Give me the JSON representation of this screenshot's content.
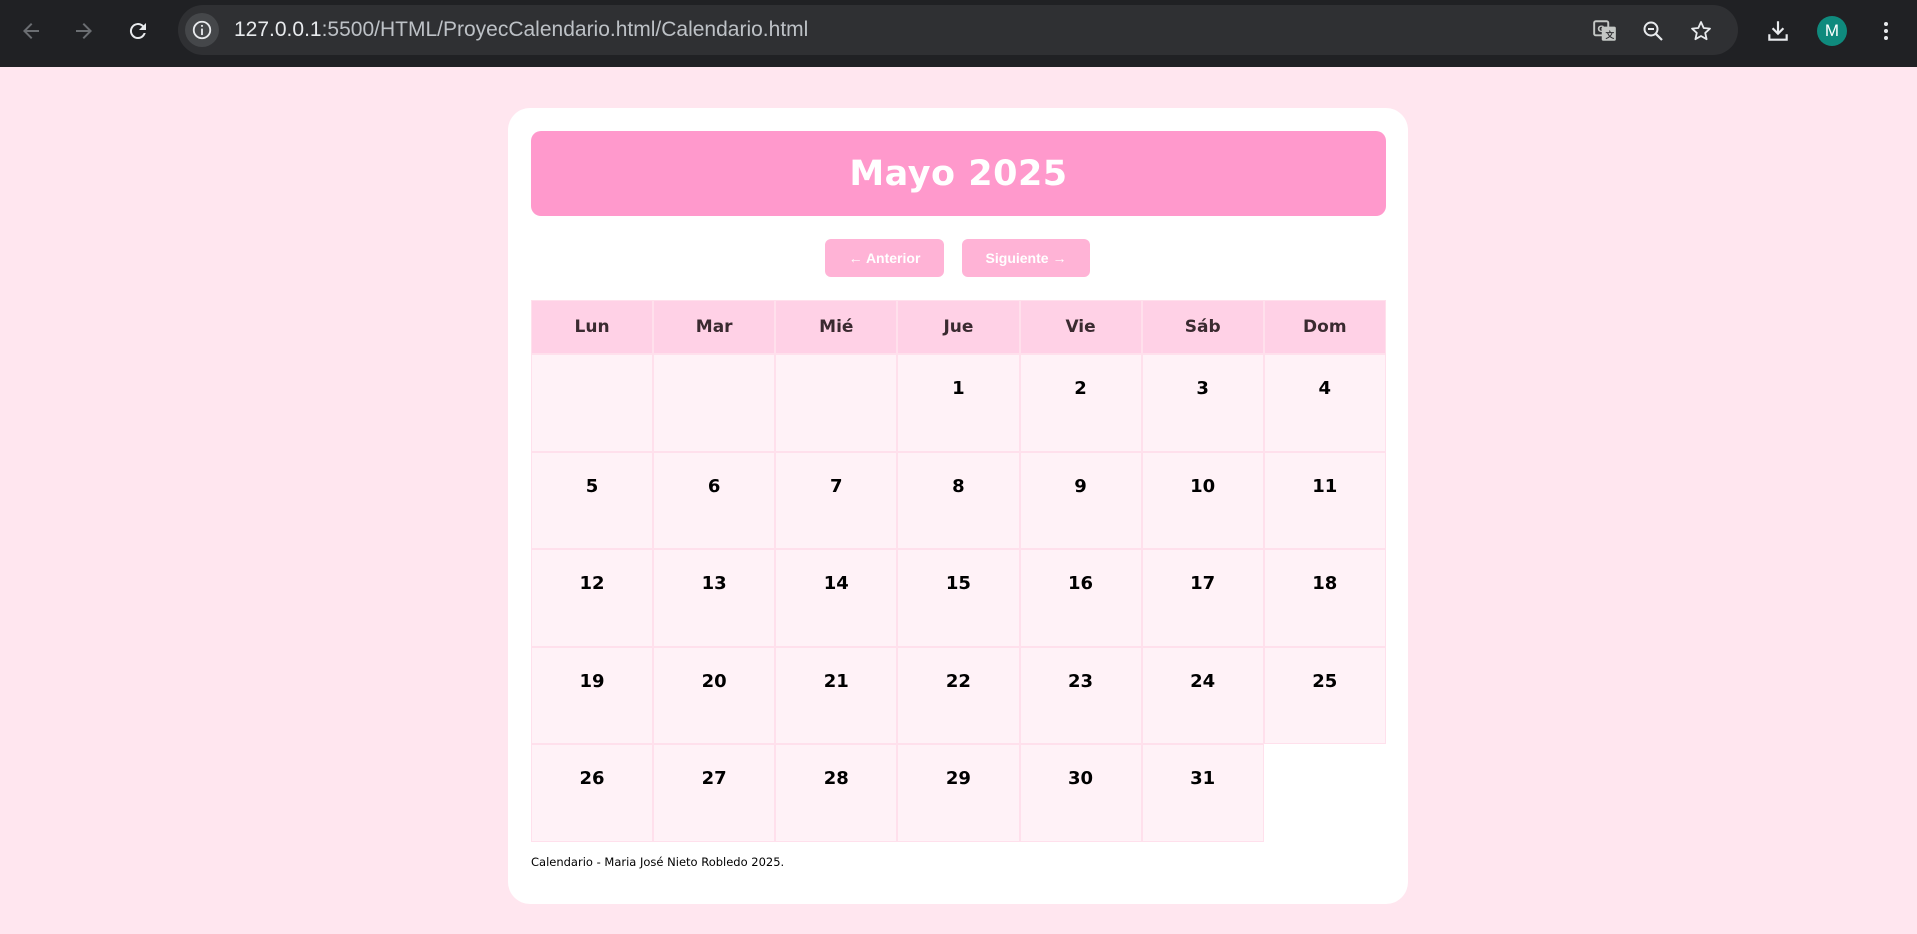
{
  "browser": {
    "url_host": "127.0.0.1",
    "url_rest": ":5500/HTML/ProyecCalendario.html/Calendario.html",
    "avatar_letter": "M",
    "icons": [
      "back-arrow-icon",
      "forward-arrow-icon",
      "reload-icon",
      "info-icon",
      "translate-icon",
      "zoom-out-icon",
      "star-icon",
      "download-icon",
      "kebab-menu-icon"
    ]
  },
  "calendar": {
    "title": "Mayo 2025",
    "prev_label": "← Anterior",
    "next_label": "Siguiente →",
    "weekdays": [
      "Lun",
      "Mar",
      "Mié",
      "Jue",
      "Vie",
      "Sáb",
      "Dom"
    ],
    "weeks": [
      [
        "",
        "",
        "",
        "1",
        "2",
        "3",
        "4"
      ],
      [
        "5",
        "6",
        "7",
        "8",
        "9",
        "10",
        "11"
      ],
      [
        "12",
        "13",
        "14",
        "15",
        "16",
        "17",
        "18"
      ],
      [
        "19",
        "20",
        "21",
        "22",
        "23",
        "24",
        "25"
      ],
      [
        "26",
        "27",
        "28",
        "29",
        "30",
        "31",
        null
      ]
    ],
    "footer": "Calendario - Maria José Nieto Robledo 2025."
  },
  "colors": {
    "page_bg": "#ffe6ef",
    "header_bg": "#ff99cc",
    "button_bg": "#ffb3d6",
    "weekday_bg": "#ffd1e6",
    "day_bg": "#fff2f7"
  }
}
